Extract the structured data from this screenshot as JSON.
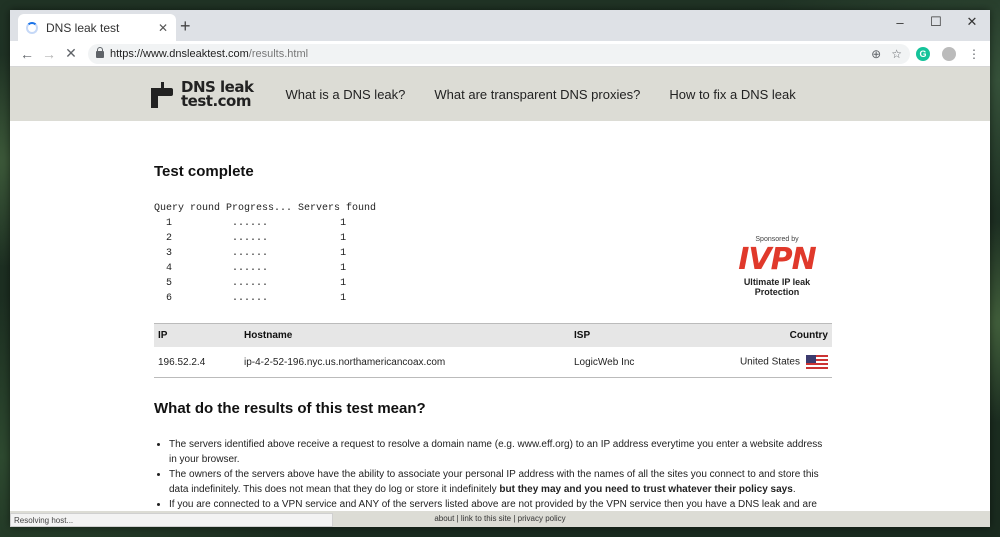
{
  "browser": {
    "tab_title": "DNS leak test",
    "new_tab": "+",
    "window_controls": [
      "–",
      "☐",
      "✕"
    ],
    "url_host": "https://www.dnsleaktest.com",
    "url_path": "/results.html",
    "status_text": "Resolving host..."
  },
  "site": {
    "logo_line1": "DNS leak",
    "logo_line2": "test.com",
    "nav": [
      "What is a DNS leak?",
      "What are transparent DNS proxies?",
      "How to fix a DNS leak"
    ]
  },
  "results": {
    "title": "Test complete",
    "progress_header": "Query round Progress... Servers found",
    "rounds": [
      {
        "round": "1",
        "progress": "......",
        "servers": "1"
      },
      {
        "round": "2",
        "progress": "......",
        "servers": "1"
      },
      {
        "round": "3",
        "progress": "......",
        "servers": "1"
      },
      {
        "round": "4",
        "progress": "......",
        "servers": "1"
      },
      {
        "round": "5",
        "progress": "......",
        "servers": "1"
      },
      {
        "round": "6",
        "progress": "......",
        "servers": "1"
      }
    ],
    "sponsor_label": "Sponsored by",
    "sponsor_name": "IVPN",
    "sponsor_tagline": "Ultimate IP leak Protection",
    "table_headers": [
      "IP",
      "Hostname",
      "ISP",
      "Country"
    ],
    "table_rows": [
      {
        "ip": "196.52.2.4",
        "hostname": "ip-4-2-52-196.nyc.us.northamericancoax.com",
        "isp": "LogicWeb Inc",
        "country": "United States"
      }
    ]
  },
  "explanation": {
    "title": "What do the results of this test mean?",
    "bullet1": "The servers identified above receive a request to resolve a domain name (e.g. www.eff.org) to an IP address everytime you enter a website address in your browser.",
    "bullet2_a": "The owners of the servers above have the ability to associate your personal IP address with the names of all the sites you connect to and store this data indefinitely. This does not mean that they do log or store it indefinitely ",
    "bullet2_b": "but they may and you need to trust whatever their policy says",
    "bullet2_c": ".",
    "bullet3": "If you are connected to a VPN service and ANY of the servers listed above are not provided by the VPN service then you have a DNS leak and are choosing to trust the owners of the above servers with your private data."
  },
  "footer": {
    "text": "about | link to this site | privacy policy"
  }
}
